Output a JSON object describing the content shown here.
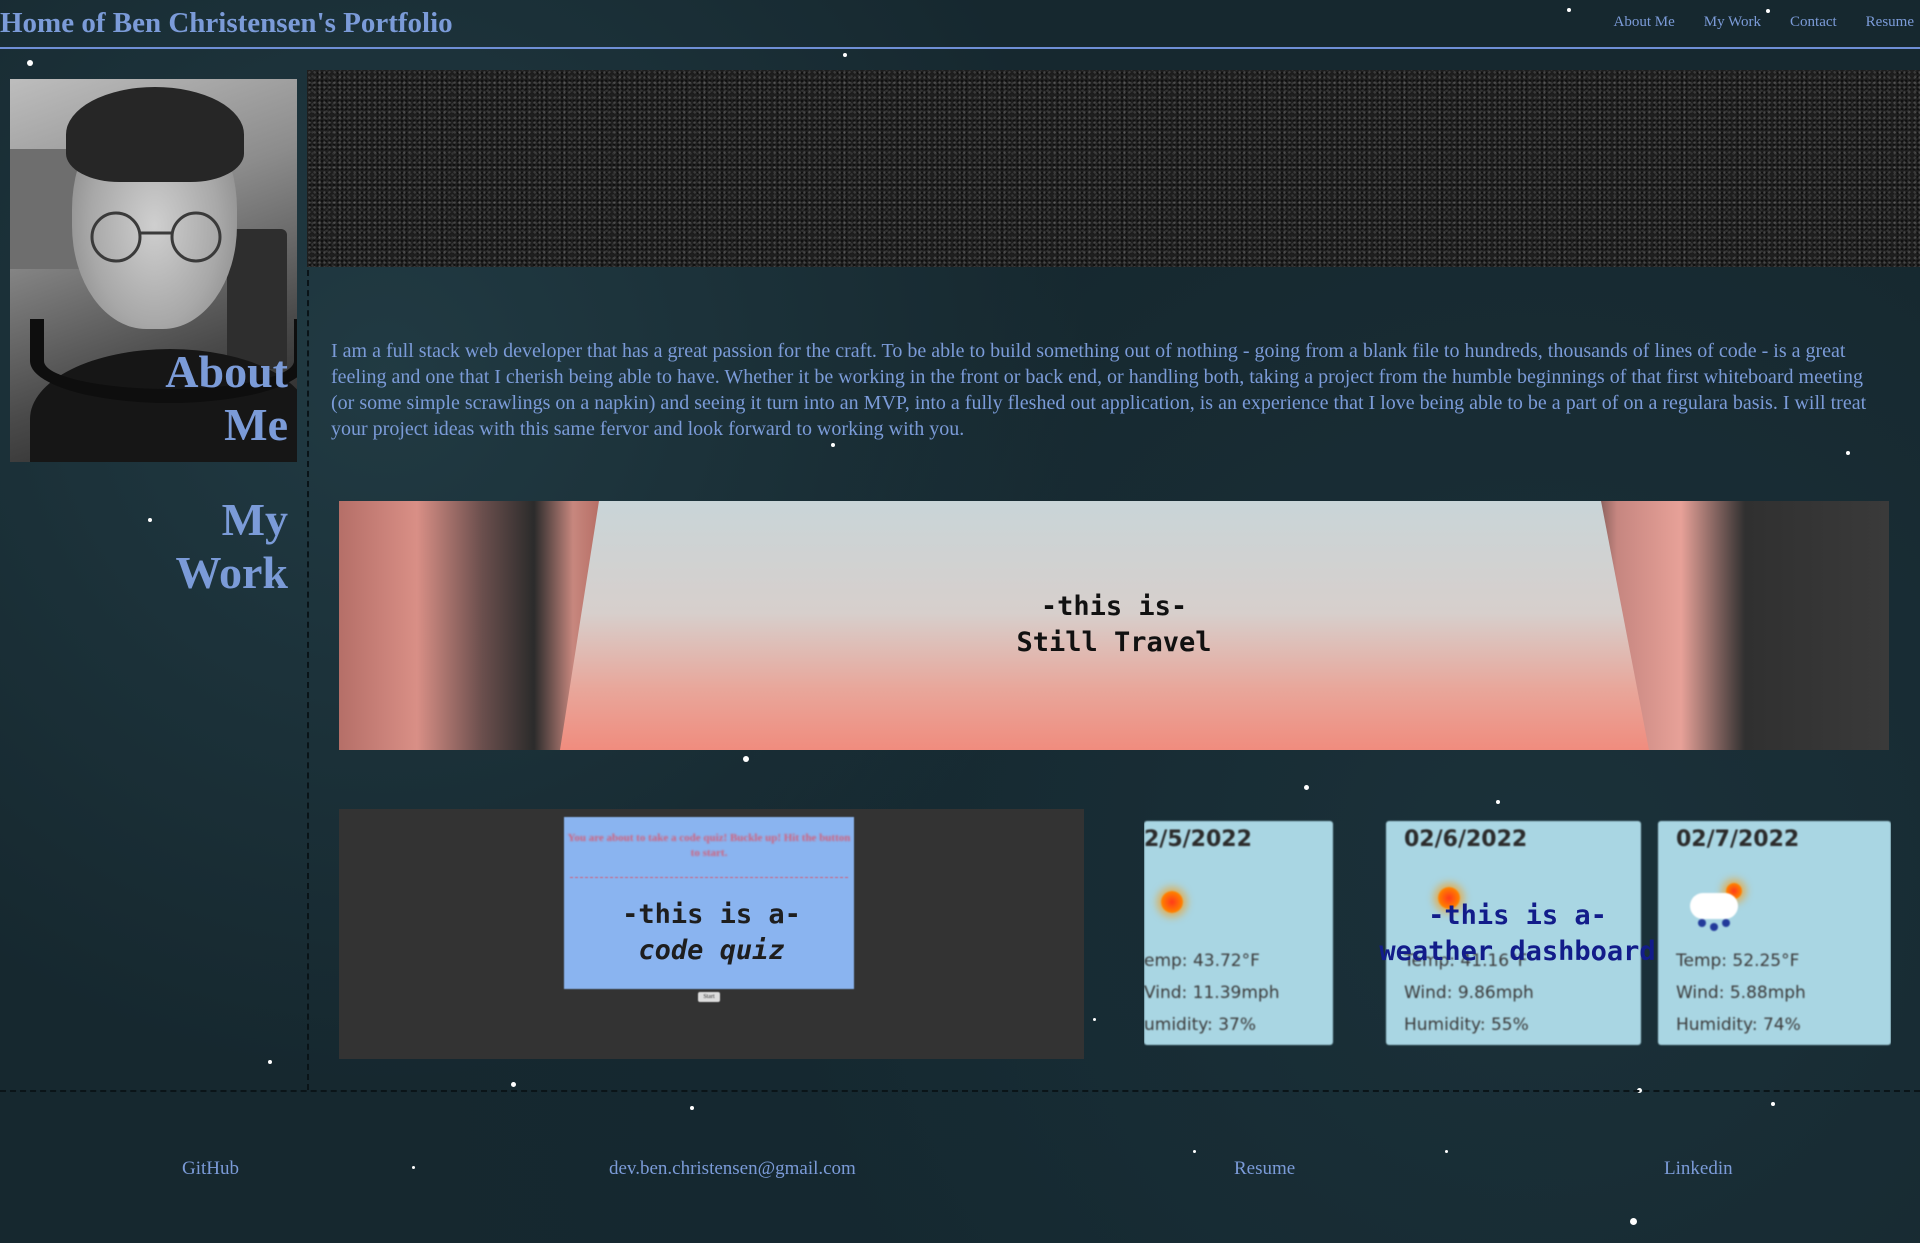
{
  "header": {
    "title": "Home of Ben Christensen's Portfolio",
    "nav": [
      "About Me",
      "My Work",
      "Contact",
      "Resume"
    ]
  },
  "sidebar": {
    "about_heading_line1": "About",
    "about_heading_line2": "Me",
    "work_heading_line1": "My",
    "work_heading_line2": "Work"
  },
  "about": {
    "text": "I am a full stack web developer that has a great passion for the craft. To be able to build something out of nothing - going from a blank file to hundreds, thousands of lines of code - is a great feeling and one that I cherish being able to have. Whether it be working in the front or back end, or handling both, taking a project from the humble beginnings of that first whiteboard meeting (or some simple scrawlings on a napkin) and seeing it turn into an MVP, into a fully fleshed out application, is an experience that I love being able to be a part of on a regulara basis. I will treat your project ideas with this same fervor and look forward to working with you."
  },
  "projects": {
    "travel": {
      "line1": "-this is-",
      "line2": "Still Travel"
    },
    "quiz": {
      "line1": "-this is a-",
      "line2": "code quiz",
      "intro": "You are about to take a code quiz! Buckle up! Hit the button to start.",
      "start_label": "Start"
    },
    "weather": {
      "line1": "-this is a-",
      "line2": "weather dashboard",
      "days": [
        {
          "date": "2/5/2022",
          "temp": "emp: 43.72°F",
          "wind": "Vind: 11.39mph",
          "humidity": "umidity: 37%"
        },
        {
          "date": "02/6/2022",
          "temp": "Temp: 41.16°F",
          "wind": "Wind: 9.86mph",
          "humidity": "Humidity: 55%"
        },
        {
          "date": "02/7/2022",
          "temp": "Temp: 52.25°F",
          "wind": "Wind: 5.88mph",
          "humidity": "Humidity: 74%"
        }
      ],
      "icons": [
        "sun-icon",
        "sun-icon",
        "rain-cloud-icon"
      ]
    }
  },
  "footer": {
    "links": [
      "GitHub",
      "dev.ben.christensen@gmail.com",
      "Resume",
      "Linkedin"
    ]
  },
  "colors": {
    "background": "#16282f",
    "accent_text": "#7b9bd8",
    "quiz_panel": "#8ab4f0",
    "weather_card": "#a9d6e3",
    "weather_caption": "#121c8a"
  }
}
